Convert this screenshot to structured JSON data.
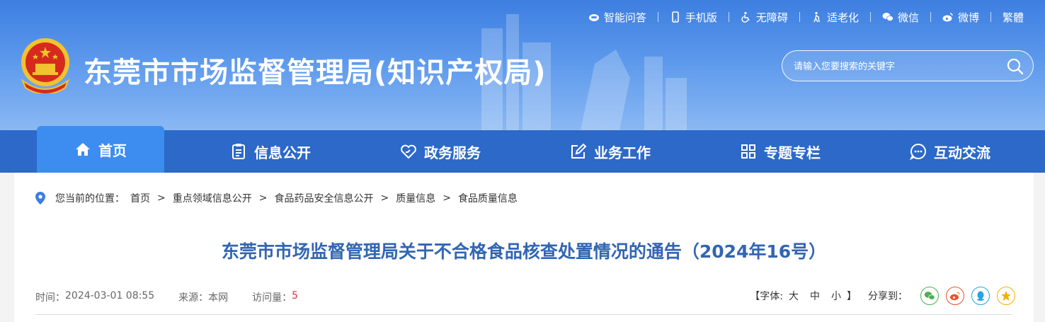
{
  "header": {
    "site_title": "东莞市市场监督管理局(知识产权局)",
    "toplinks": [
      {
        "label": "智能问答",
        "icon": "robot-icon"
      },
      {
        "label": "手机版",
        "icon": "mobile-icon"
      },
      {
        "label": "无障碍",
        "icon": "wheelchair-icon"
      },
      {
        "label": "适老化",
        "icon": "elder-icon"
      },
      {
        "label": "微信",
        "icon": "wechat-icon"
      },
      {
        "label": "微博",
        "icon": "weibo-icon"
      },
      {
        "label": "繁體",
        "icon": ""
      }
    ],
    "search_placeholder": "请输入您要搜索的关键字"
  },
  "nav": {
    "items": [
      {
        "label": "首页",
        "icon": "home-icon",
        "active": true
      },
      {
        "label": "信息公开",
        "icon": "document-icon"
      },
      {
        "label": "政务服务",
        "icon": "heart-hand-icon"
      },
      {
        "label": "业务工作",
        "icon": "edit-icon"
      },
      {
        "label": "专题专栏",
        "icon": "grid-icon"
      },
      {
        "label": "互动交流",
        "icon": "chat-icon"
      }
    ]
  },
  "breadcrumb": {
    "prefix": "您当前的位置：",
    "items": [
      "首页",
      "重点领域信息公开",
      "食品药品安全信息公开",
      "质量信息",
      "食品质量信息"
    ],
    "separator": ">"
  },
  "article": {
    "title": "东莞市市场监督管理局关于不合格食品核查处置情况的通告（2024年16号）",
    "time_label": "时间：",
    "time": "2024-03-01 08:55",
    "source_label": "来源：",
    "source": "本网",
    "visits_label": "访问量：",
    "visits": "5"
  },
  "tools": {
    "font_label_open": "【字体:",
    "font_sizes": [
      "大",
      "中",
      "小"
    ],
    "font_label_close": "】",
    "share_label": "分享到：",
    "share_targets": [
      {
        "name": "wechat",
        "color": "#4caf50"
      },
      {
        "name": "weibo",
        "color": "#e8542e"
      },
      {
        "name": "qq",
        "color": "#2aa3e0"
      },
      {
        "name": "qzone",
        "color": "#f0b400"
      }
    ]
  }
}
